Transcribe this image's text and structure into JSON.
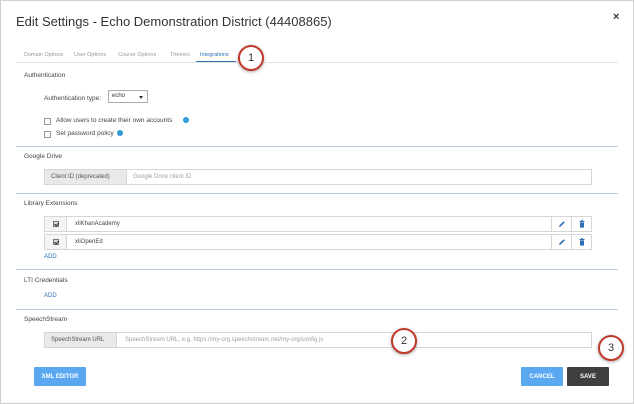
{
  "dialog": {
    "title": "Edit Settings - Echo Demonstration District (44408865)",
    "close_glyph": "×"
  },
  "tabs": [
    {
      "label": "Domain Options",
      "active": false
    },
    {
      "label": "User Options",
      "active": false
    },
    {
      "label": "Course Options",
      "active": false
    },
    {
      "label": "Themes",
      "active": false
    },
    {
      "label": "Integrations",
      "active": true
    }
  ],
  "callouts": [
    "1",
    "2",
    "3"
  ],
  "authentication": {
    "heading": "Authentication",
    "type_label": "Authentication type:",
    "type_value": "echo",
    "allow_create_label": "Allow users to create their own accounts",
    "password_policy_label": "Set password policy"
  },
  "google_drive": {
    "heading": "Google Drive",
    "addon_label": "Client ID (deprecated)",
    "placeholder": "Google Drive client ID"
  },
  "library_extensions": {
    "heading": "Library Extensions",
    "items": [
      {
        "name": "xliKhanAcademy",
        "checked": true
      },
      {
        "name": "xliOpenEd",
        "checked": true
      }
    ],
    "add_label": "ADD"
  },
  "lti": {
    "heading": "LTI Credentials",
    "add_label": "ADD"
  },
  "speechstream": {
    "heading": "SpeechStream",
    "addon_label": "SpeechStream URL",
    "placeholder": "SpeechStream URL, e.g. https://my-org.speechstream.net/my-org/config.js"
  },
  "footer": {
    "xml_editor_label": "XML EDITOR",
    "cancel_label": "CANCEL",
    "save_label": "SAVE"
  },
  "colors": {
    "accent": "#2d6fb7",
    "button_blue": "#5aa9f0",
    "save_dark": "#3f3f3f",
    "callout_ring": "#c0392b",
    "help_icon": "#2f9bd6"
  }
}
